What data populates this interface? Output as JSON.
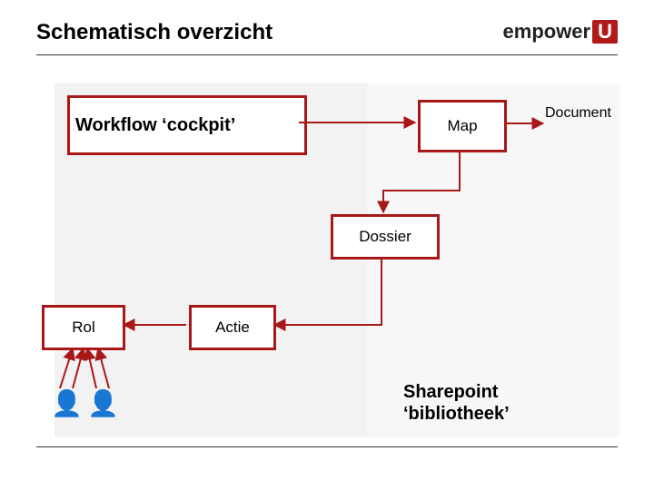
{
  "title": "Schematisch overzicht",
  "logo": {
    "brand": "empower",
    "suffix": "U"
  },
  "boxes": {
    "workflow": "Workflow ‘cockpit’",
    "map": "Map",
    "document": "Document",
    "dossier": "Dossier",
    "rol": "Rol",
    "actie": "Actie"
  },
  "sharepoint_line1": "Sharepoint",
  "sharepoint_line2": "‘bibliotheek’",
  "colors": {
    "accent": "#a81818"
  }
}
